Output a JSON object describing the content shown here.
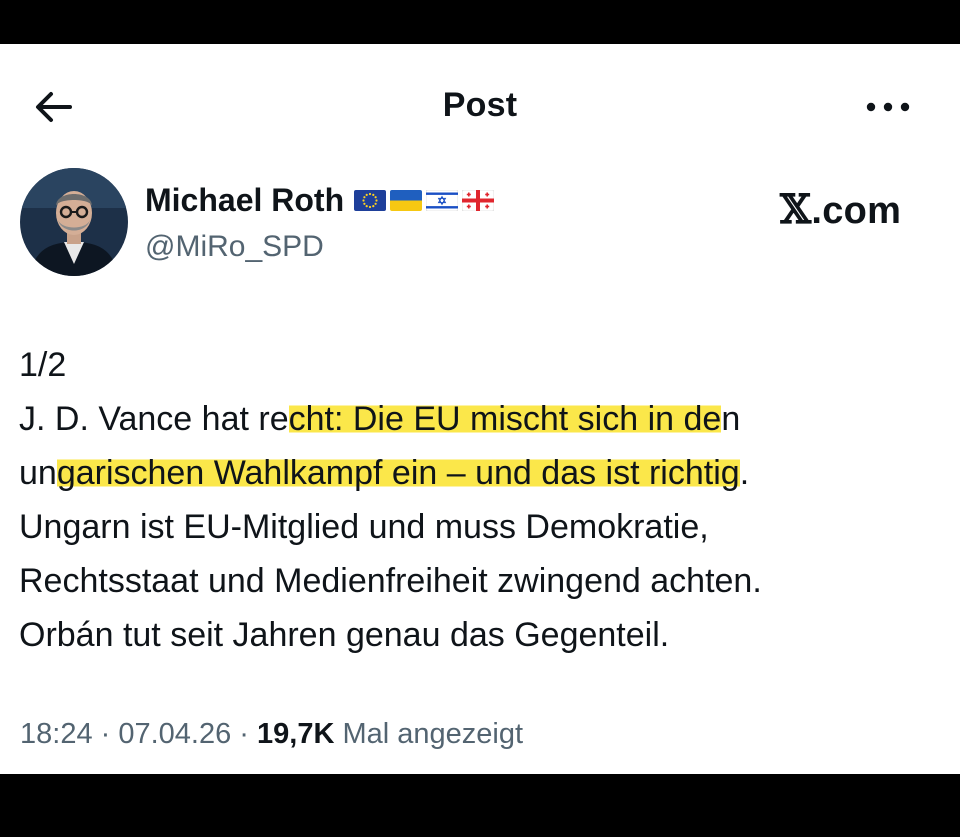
{
  "header": {
    "back_icon": "arrow-left-icon",
    "title": "Post",
    "more_icon": "more-horizontal-icon"
  },
  "author": {
    "name": "Michael Roth",
    "handle": "@MiRo_SPD",
    "flags": [
      "eu-flag-icon",
      "ukraine-flag-icon",
      "israel-flag-icon",
      "georgia-flag-icon"
    ]
  },
  "brand": {
    "x": "𝕏",
    "rest": ".com"
  },
  "post": {
    "counter": "1/2",
    "line1_a": "J. D. Vance hat re",
    "line1_hl": "cht: Die EU mischt sich in de",
    "line1_b": "n",
    "line2_a": "un",
    "line2_hl": "garischen Wahlkampf ein – und das ist richtig",
    "line2_b": ".",
    "line3": "Ungarn ist EU-Mitglied und muss Demokratie,",
    "line4": "Rechtsstaat und Medienfreiheit zwingend achten.",
    "line5": "Orbán tut seit Jahren genau das Gegenteil."
  },
  "meta": {
    "time": "18:24",
    "sep1": " · ",
    "date": "07.04.26",
    "sep2": " · ",
    "views": "19,7K",
    "views_label": " Mal angezeigt"
  },
  "colors": {
    "highlight": "#fbe74a",
    "text": "#0f1419",
    "secondary": "#536471"
  }
}
